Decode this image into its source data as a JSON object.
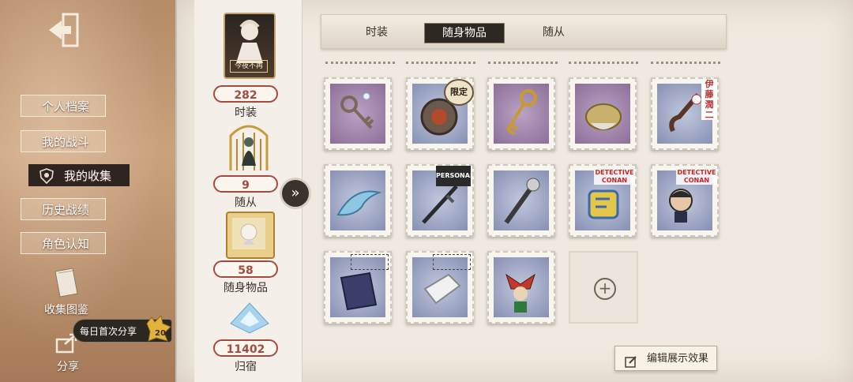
{
  "sidebar": {
    "nav": [
      "个人档案",
      "我的战斗",
      "我的收集",
      "历史战绩",
      "角色认知"
    ],
    "active_index": 2,
    "collection_label": "收集图鉴",
    "share_label": "分享",
    "share_tip": "每日首次分享",
    "share_reward": "20"
  },
  "summary": {
    "costume_title": "今夜不再",
    "costume_count": "282",
    "costume_label": "时装",
    "follower_count": "9",
    "follower_label": "随从",
    "item_count": "58",
    "item_label": "随身物品",
    "home_count": "11402",
    "home_label": "归宿"
  },
  "tabs": [
    "时装",
    "随身物品",
    "随从"
  ],
  "active_tab": 1,
  "grid": {
    "badges": {
      "limited": "限定",
      "ito": "伊藤潤二",
      "p5": "PERSONA5",
      "conan1": "DETECTIVE CONAN",
      "conan2": "DETECTIVE CONAN"
    }
  },
  "edit_button": "编辑展示效果",
  "colors": {
    "accent_red": "#a54a40",
    "dark": "#2e2822"
  }
}
